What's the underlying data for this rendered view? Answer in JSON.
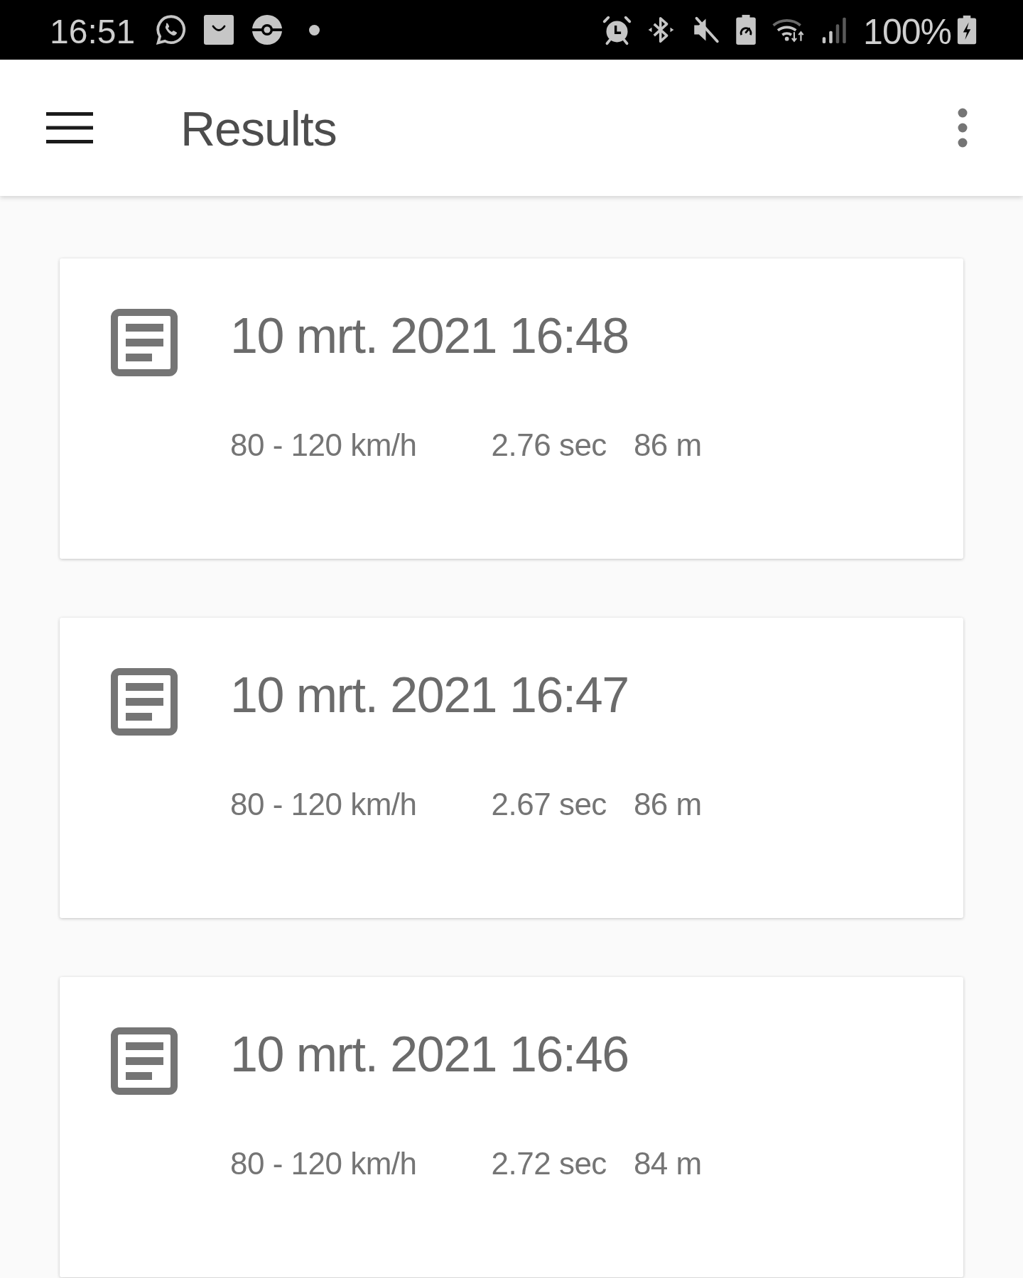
{
  "status_bar": {
    "time": "16:51",
    "battery": "100%"
  },
  "app_bar": {
    "title": "Results"
  },
  "results": [
    {
      "date": "10 mrt. 2021 16:48",
      "speed_range": "80 - 120 km/h",
      "time": "2.76 sec",
      "distance": "86 m"
    },
    {
      "date": "10 mrt. 2021 16:47",
      "speed_range": "80 - 120 km/h",
      "time": "2.67 sec",
      "distance": "86 m"
    },
    {
      "date": "10 mrt. 2021 16:46",
      "speed_range": "80 - 120 km/h",
      "time": "2.72 sec",
      "distance": "84 m"
    }
  ]
}
